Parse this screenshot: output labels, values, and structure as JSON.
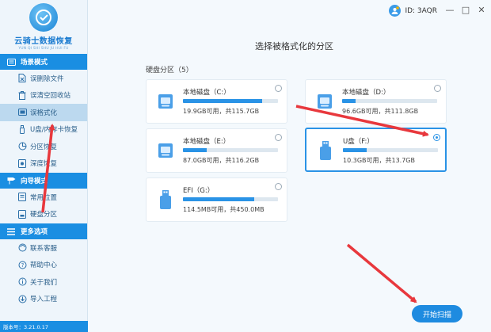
{
  "app": {
    "title": "云骑士数据恢复",
    "subtitle": "YUN QI SHI SHU JU HUI FU",
    "version": "版本号：3.21.0.17"
  },
  "titlebar": {
    "user_id": "ID: 3AQR",
    "minimize": "—",
    "maximize": "□",
    "close": "✕"
  },
  "sidebar": {
    "sections": [
      {
        "label": "场景模式",
        "items": [
          {
            "label": "误删除文件",
            "icon": "delete-file-icon",
            "active": false
          },
          {
            "label": "误清空回收站",
            "icon": "recycle-bin-icon",
            "active": false
          },
          {
            "label": "误格式化",
            "icon": "format-icon",
            "active": true
          },
          {
            "label": "U盘/内存卡恢复",
            "icon": "usb-icon",
            "active": false
          },
          {
            "label": "分区恢复",
            "icon": "partition-icon",
            "active": false
          },
          {
            "label": "深度恢复",
            "icon": "deep-recovery-icon",
            "active": false
          }
        ]
      },
      {
        "label": "向导模式",
        "items": [
          {
            "label": "常用位置",
            "icon": "location-icon",
            "active": false
          },
          {
            "label": "硬盘分区",
            "icon": "disk-partition-icon",
            "active": false
          }
        ]
      },
      {
        "label": "更多选项",
        "items": [
          {
            "label": "联系客服",
            "icon": "support-icon",
            "active": false
          },
          {
            "label": "帮助中心",
            "icon": "help-icon",
            "active": false
          },
          {
            "label": "关于我们",
            "icon": "about-icon",
            "active": false
          },
          {
            "label": "导入工程",
            "icon": "import-icon",
            "active": false
          }
        ]
      }
    ]
  },
  "main": {
    "title": "选择被格式化的分区",
    "disk_header": "硬盘分区（5）",
    "partitions": [
      {
        "name": "本地磁盘（C:）",
        "size": "19.9GB可用，共115.7GB",
        "used_fraction": 0.83,
        "type": "hdd",
        "selected": false
      },
      {
        "name": "本地磁盘（D:）",
        "size": "96.6GB可用，共111.8GB",
        "used_fraction": 0.14,
        "type": "hdd",
        "selected": false
      },
      {
        "name": "本地磁盘（E:）",
        "size": "87.0GB可用，共116.2GB",
        "used_fraction": 0.25,
        "type": "hdd",
        "selected": false
      },
      {
        "name": "U盘（F:）",
        "size": "10.3GB可用，共13.7GB",
        "used_fraction": 0.25,
        "type": "usb",
        "selected": true
      },
      {
        "name": "EFI（G:）",
        "size": "114.5MB可用，共450.0MB",
        "used_fraction": 0.75,
        "type": "usb",
        "selected": false
      }
    ],
    "scan_button": "开始扫描"
  },
  "colors": {
    "accent": "#1a8ee2",
    "arrow": "#e8383d"
  }
}
